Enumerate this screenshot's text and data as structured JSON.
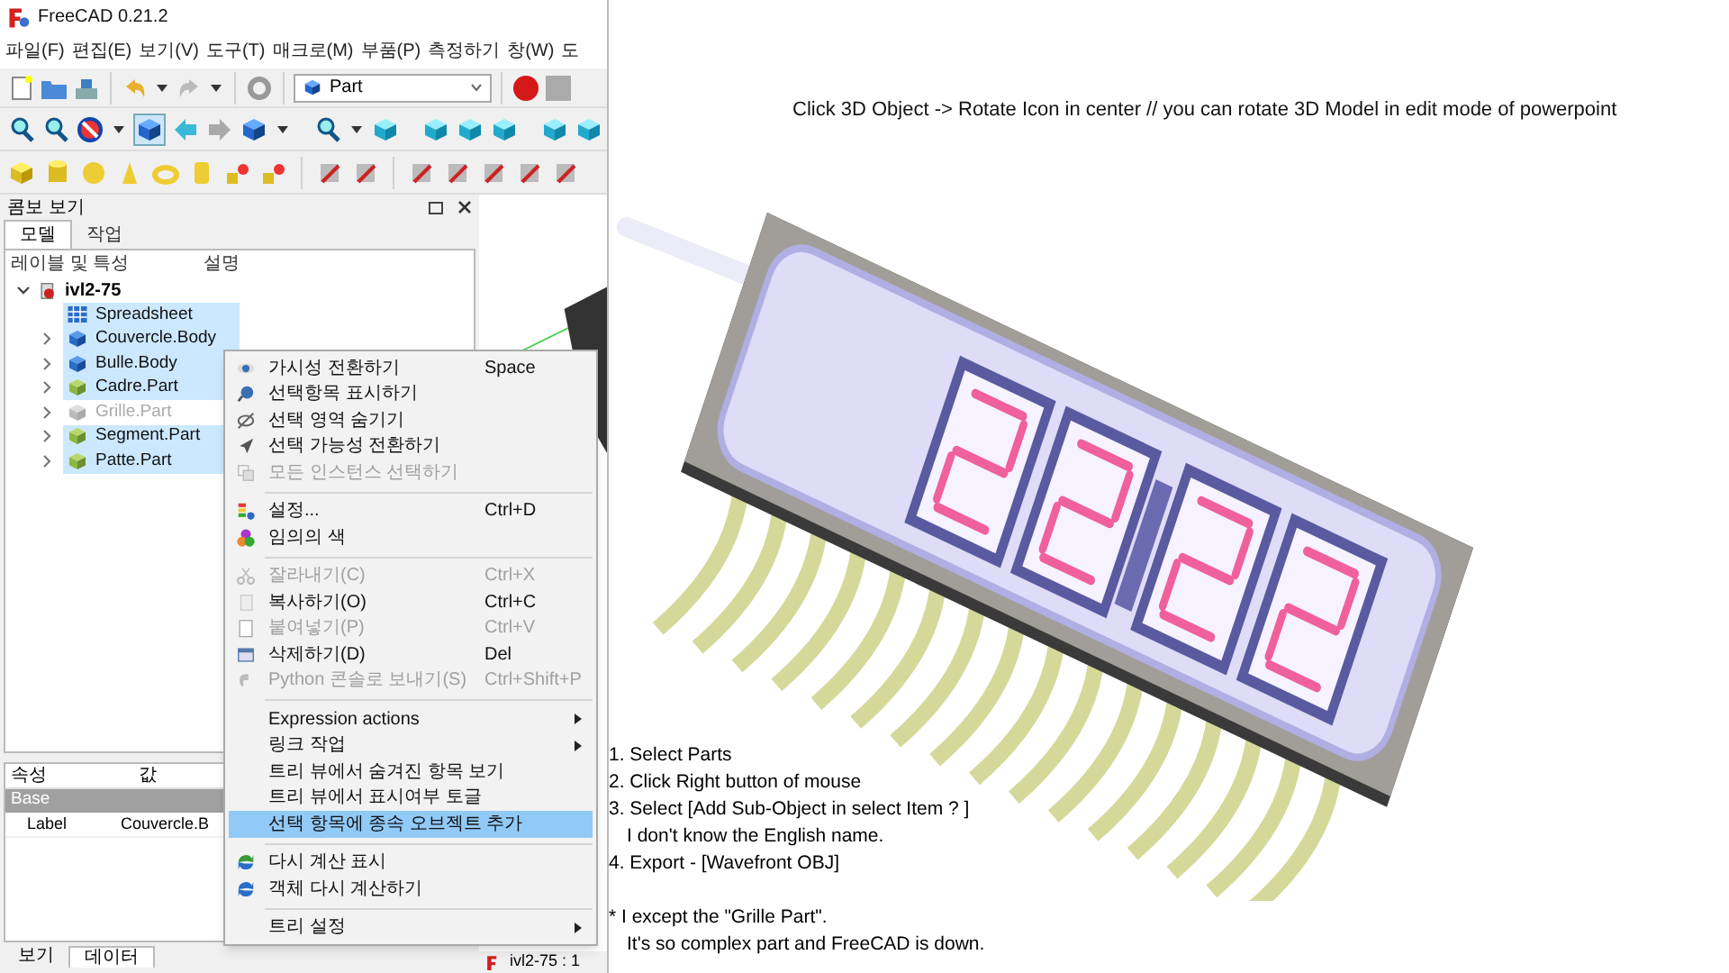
{
  "window": {
    "title": "FreeCAD 0.21.2"
  },
  "menu_bar": [
    "파일(F)",
    "편집(E)",
    "보기(V)",
    "도구(T)",
    "매크로(M)",
    "부품(P)",
    "측정하기",
    "창(W)",
    "도"
  ],
  "workbench_select": {
    "value": "Part"
  },
  "combo_view": {
    "title": "콤보 보기",
    "tabs": [
      {
        "label": "모델",
        "selected": true
      },
      {
        "label": "작업",
        "selected": false
      }
    ],
    "columns": [
      "레이블 및 특성",
      "설명"
    ],
    "tree": [
      {
        "label": "ivl2-75",
        "kind": "document",
        "expanded": true,
        "selected": false,
        "hidden": false,
        "children": [
          {
            "label": "Spreadsheet",
            "kind": "spreadsheet",
            "expandable": false,
            "selected": true,
            "hidden": false
          },
          {
            "label": "Couvercle.Body",
            "kind": "body",
            "expandable": true,
            "selected": true,
            "hidden": false
          },
          {
            "label": "Bulle.Body",
            "kind": "body",
            "expandable": true,
            "selected": true,
            "hidden": false
          },
          {
            "label": "Cadre.Part",
            "kind": "part",
            "expandable": true,
            "selected": true,
            "hidden": false
          },
          {
            "label": "Grille.Part",
            "kind": "part",
            "expandable": true,
            "selected": false,
            "hidden": true
          },
          {
            "label": "Segment.Part",
            "kind": "part",
            "expandable": true,
            "selected": true,
            "hidden": false
          },
          {
            "label": "Patte.Part",
            "kind": "part",
            "expandable": true,
            "selected": true,
            "hidden": false
          }
        ]
      }
    ]
  },
  "properties": {
    "columns": [
      "속성",
      "값"
    ],
    "group": "Base",
    "rows": [
      {
        "name": "Label",
        "value": "Couvercle.B"
      }
    ]
  },
  "bottom_tabs": [
    {
      "label": "보기",
      "selected": false
    },
    {
      "label": "데이터",
      "selected": true
    }
  ],
  "document_tab": "ivl2-75 : 1",
  "context_menu": [
    {
      "kind": "item",
      "label": "가시성 전환하기",
      "shortcut": "Space",
      "disabled": false,
      "highlighted": false
    },
    {
      "kind": "item",
      "label": "선택항목 표시하기",
      "disabled": false,
      "highlighted": false
    },
    {
      "kind": "item",
      "label": "선택 영역 숨기기",
      "disabled": false,
      "highlighted": false
    },
    {
      "kind": "item",
      "label": "선택 가능성 전환하기",
      "disabled": false,
      "highlighted": false
    },
    {
      "kind": "item",
      "label": "모든 인스턴스 선택하기",
      "disabled": true,
      "highlighted": false
    },
    {
      "kind": "separator"
    },
    {
      "kind": "item",
      "label": "설정...",
      "shortcut": "Ctrl+D",
      "disabled": false,
      "highlighted": false
    },
    {
      "kind": "item",
      "label": "임의의 색",
      "disabled": false,
      "highlighted": false
    },
    {
      "kind": "separator"
    },
    {
      "kind": "item",
      "label": "잘라내기(C)",
      "shortcut": "Ctrl+X",
      "disabled": true,
      "highlighted": false
    },
    {
      "kind": "item",
      "label": "복사하기(O)",
      "shortcut": "Ctrl+C",
      "disabled": false,
      "highlighted": false
    },
    {
      "kind": "item",
      "label": "붙여넣기(P)",
      "shortcut": "Ctrl+V",
      "disabled": true,
      "highlighted": false
    },
    {
      "kind": "item",
      "label": "삭제하기(D)",
      "shortcut": "Del",
      "disabled": false,
      "highlighted": false
    },
    {
      "kind": "item",
      "label": "Python 콘솔로 보내기(S)",
      "shortcut": "Ctrl+Shift+P",
      "disabled": true,
      "highlighted": false
    },
    {
      "kind": "separator"
    },
    {
      "kind": "submenu",
      "label": "Expression actions",
      "disabled": false,
      "highlighted": false
    },
    {
      "kind": "submenu",
      "label": "링크 작업",
      "disabled": false,
      "highlighted": false
    },
    {
      "kind": "item",
      "label": "트리 뷰에서 숨겨진 항목 보기",
      "disabled": false,
      "highlighted": false
    },
    {
      "kind": "item",
      "label": "트리 뷰에서 표시여부 토글",
      "disabled": false,
      "highlighted": false
    },
    {
      "kind": "item",
      "label": "선택 항목에 종속 오브젝트 추가",
      "disabled": false,
      "highlighted": true
    },
    {
      "kind": "separator"
    },
    {
      "kind": "item",
      "label": "다시 계산 표시",
      "disabled": false,
      "highlighted": false
    },
    {
      "kind": "item",
      "label": "객체 다시 계산하기",
      "disabled": false,
      "highlighted": false
    },
    {
      "kind": "separator"
    },
    {
      "kind": "submenu",
      "label": "트리 설정",
      "disabled": false,
      "highlighted": false
    }
  ],
  "slide": {
    "heading": "Click 3D Object -> Rotate Icon in center // you can rotate 3D Model in edit mode of powerpoint",
    "steps": [
      {
        "text": "1. Select Parts",
        "indent": false
      },
      {
        "text": "2. Click Right button of mouse",
        "indent": false
      },
      {
        "text": "3. Select [Add Sub-Object in select Item ? ]",
        "indent": false
      },
      {
        "text": "I don't know the English name.",
        "indent": true
      },
      {
        "text": "4. Export - [Wavefront OBJ]",
        "indent": false
      }
    ],
    "note": [
      {
        "text": "* I except the \"Grille Part\".",
        "indent": false
      },
      {
        "text": "It's so complex part and FreeCAD is down.",
        "indent": true
      }
    ]
  }
}
